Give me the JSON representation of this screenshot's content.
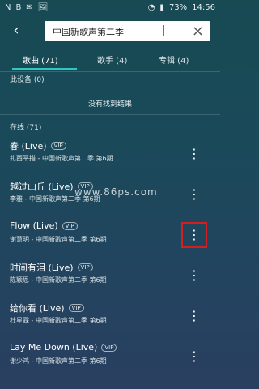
{
  "statusbar": {
    "left_icons": [
      "N",
      "B",
      "✉",
      "🖼"
    ],
    "signal_text": "73%",
    "time": "14:56"
  },
  "search": {
    "value": "中国新歌声第二季"
  },
  "tabs": [
    {
      "label": "歌曲 (71)",
      "active": true
    },
    {
      "label": "歌手 (4)",
      "active": false
    },
    {
      "label": "专辑 (4)",
      "active": false
    }
  ],
  "sections": {
    "device_title": "此设备 (0)",
    "no_result": "没有找到结果",
    "online_title": "在线 (71)"
  },
  "items": [
    {
      "title": "春 (Live)",
      "badge": "VIP",
      "meta": "扎西平措 - 中国新歌声第二季 第6期"
    },
    {
      "title": "越过山丘 (Live)",
      "badge": "VIP",
      "meta": "李雅 - 中国新歌声第二季 第6期"
    },
    {
      "title": "Flow (Live)",
      "badge": "VIP",
      "meta": "谢慧明 - 中国新歌声第二季 第6期"
    },
    {
      "title": "时间有泪 (Live)",
      "badge": "VIP",
      "meta": "陈颖恩 - 中国新歌声第二季 第6期"
    },
    {
      "title": "给你看 (Live)",
      "badge": "VIP",
      "meta": "杜星霖 - 中国新歌声第二季 第6期"
    },
    {
      "title": "Lay Me Down (Live)",
      "badge": "VIP",
      "meta": "谢少鸿 - 中国新歌声第二季 第6期"
    }
  ],
  "watermark": "www.86ps.com",
  "colors": {
    "accent": "#2fc7c0",
    "highlight": "#d51f1f"
  }
}
